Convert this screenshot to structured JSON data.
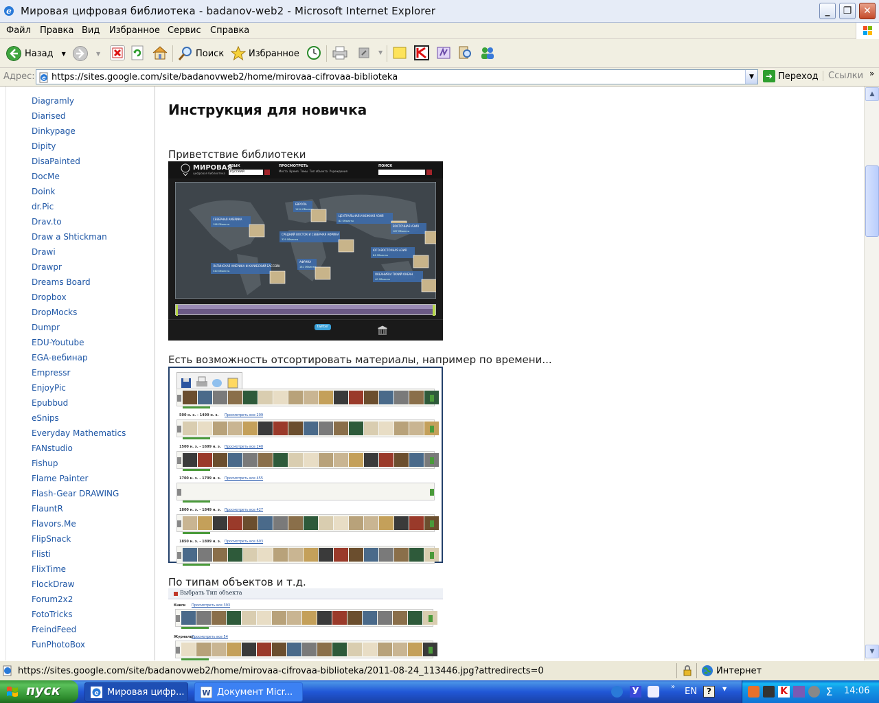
{
  "window": {
    "title": "Мировая цифровая библиотека - badanov-web2 - Microsoft Internet Explorer"
  },
  "menu": [
    "Файл",
    "Правка",
    "Вид",
    "Избранное",
    "Сервис",
    "Справка"
  ],
  "toolbar": {
    "back_label": "Назад",
    "search_label": "Поиск",
    "favorites_label": "Избранное"
  },
  "address": {
    "label": "Адрес:",
    "url": "https://sites.google.com/site/badanovweb2/home/mirovaa-cifrovaa-biblioteka",
    "go_label": "Переход",
    "links_label": "Ссылки",
    "links_more": "»"
  },
  "sidebar": {
    "items": [
      "Diagramly",
      "Diarised",
      "Dinkypage",
      "Dipity",
      "DisaPainted",
      "DocMe",
      "Doink",
      "dr.Pic",
      "Drav.to",
      "Draw a Shtickman",
      "Drawi",
      "Drawpr",
      "Dreams Board",
      "Dropbox",
      "DropMocks",
      "Dumpr",
      "EDU-Youtube",
      "EGA-вебинар",
      "Empressr",
      "EnjoyPic",
      "Epubbud",
      "eSnips",
      "Everyday Mathematics",
      "FANstudio",
      "Fishup",
      "Flame Painter",
      "Flash-Gear DRAWING",
      "FlauntR",
      "Flavors.Me",
      "FlipSnack",
      "Flisti",
      "FlixTime",
      "FlockDraw",
      "Forum2x2",
      "FotoTricks",
      "FreindFeed",
      "FunPhotoBox"
    ]
  },
  "main": {
    "heading": "Инструкция для новичка",
    "caption1": "Приветствие библиотеки",
    "caption2": "Есть возможность отсортировать материалы, например по времени...",
    "caption3": "По типам объектов и т.д.",
    "shot1": {
      "logo": "МИРОВАЯ",
      "logo_sub": "цифровая библиотека",
      "lang_label": "ЯЗЫК",
      "lang_value": "Русский",
      "browse_label": "ПРОСМОТРЕТЬ",
      "browse_links": "Места  Время  Темы  Тип объекта  Учреждения",
      "search_label": "ПОИСК",
      "regions": [
        "СЕВЕРНАЯ АМЕРИКА",
        "ЕВРОПА",
        "ЦЕНТРАЛЬНАЯ И ЮЖНАЯ АЗИЯ",
        "ВОСТОЧНАЯ АЗИЯ",
        "СРЕДНИЙ ВОСТОК И СЕВЕРНАЯ АФРИКА",
        "ЮГО-ВОСТОЧНАЯ АЗИЯ",
        "ЛАТИНСКАЯ АМЕРИКА И КАРИБСКИЙ БАССЕЙН",
        "АФРИКА",
        "ОКЕАНИЯ И ТИХИЙ ОКЕАН"
      ],
      "counts": [
        "198 Объекты",
        "1124 Объекты",
        "82 Объекты",
        "187 Объекты",
        "329 Объекты",
        "84 Объекты",
        "340 Объекты",
        "181 Объекты",
        "40 Объекты"
      ],
      "footer_twitter": "twitter"
    },
    "shot2": {
      "rows": [
        "500 н. э. - 1499 н. э.",
        "1500 н. э. - 1699 н. э.",
        "1700 н. э. - 1799 н. э.",
        "1800 н. э. - 1849 н. э.",
        "1850 н. э. - 1899 н. э."
      ],
      "links": [
        "Просмотреть все 209",
        "Просмотреть все 240",
        "Просмотреть все 455",
        "Просмотреть все 427",
        "Просмотреть все 603"
      ]
    },
    "shot3": {
      "header": "Выбрать Тип объекта",
      "rows": [
        "Книги",
        "Журналы"
      ],
      "links": [
        "Просмотреть все 393",
        "Просмотреть все 54"
      ]
    }
  },
  "status": {
    "text": "https://sites.google.com/site/badanovweb2/home/mirovaa-cifrovaa-biblioteka/2011-08-24_113446.jpg?attredirects=0",
    "zone": "Интернет"
  },
  "taskbar": {
    "start": "пуск",
    "tasks": [
      "Мировая цифр...",
      "Документ Micr..."
    ],
    "lang": "EN",
    "clock": "14:06"
  },
  "colors": {
    "link": "#1f57a6",
    "taskbar": "#2157d7",
    "start": "#3c9a3c"
  }
}
